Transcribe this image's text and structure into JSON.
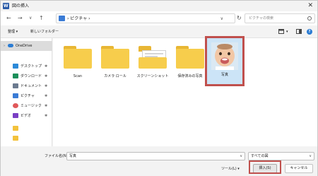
{
  "window": {
    "title": "図の挿入",
    "close_glyph": "✕"
  },
  "nav": {
    "back": "←",
    "forward": "→",
    "dropdown": "∨",
    "up": "↑",
    "breadcrumb": "› ピクチャ ›",
    "breadcrumb_chevron": "∨",
    "refresh": "↻",
    "search_placeholder": "ピクチャの検索"
  },
  "toolbar": {
    "organize": "整理 ▾",
    "new_folder": "新しいフォルダー",
    "view_dropdown": "▾",
    "help": "?"
  },
  "sidebar": {
    "items": [
      {
        "label": "OneDrive",
        "icon": "cloud-icon",
        "color": "#2b7cd3",
        "pin": ""
      },
      {
        "label": "デスクトップ",
        "icon": "desktop-icon",
        "color": "#2c8ad8",
        "pin": "✱"
      },
      {
        "label": "ダウンロード",
        "icon": "download-icon",
        "color": "#1a8f5a",
        "pin": "✱"
      },
      {
        "label": "ドキュメント",
        "icon": "document-icon",
        "color": "#6b7a8f",
        "pin": "✱"
      },
      {
        "label": "ピクチャ",
        "icon": "pictures-icon",
        "color": "#3a7bd5",
        "pin": "✱"
      },
      {
        "label": "ミュージック",
        "icon": "music-icon",
        "color": "#e0585a",
        "pin": "✱"
      },
      {
        "label": "ビデオ",
        "icon": "video-icon",
        "color": "#7a3fc4",
        "pin": "✱"
      },
      {
        "label": "",
        "icon": "folder-icon",
        "color": "#f3c23c",
        "pin": ""
      },
      {
        "label": "",
        "icon": "folder-icon",
        "color": "#f3c23c",
        "pin": ""
      }
    ]
  },
  "files": [
    {
      "label": "Scan",
      "type": "folder"
    },
    {
      "label": "カメラ ロール",
      "type": "folder"
    },
    {
      "label": "スクリーンショット",
      "type": "folder-with-preview"
    },
    {
      "label": "保存済みの写真",
      "type": "folder"
    },
    {
      "label": "写真",
      "type": "image",
      "selected": true
    }
  ],
  "footer": {
    "filename_label": "ファイル名(N):",
    "filename_value": "写真",
    "filetype_value": "すべての図",
    "tools_label": "ツール(L) ▾",
    "insert_button": "挿入(S)",
    "cancel_button": "キャンセル"
  },
  "colors": {
    "accent": "#c0504d",
    "selection": "#cce4f7",
    "folder": "#f7cd4c"
  }
}
